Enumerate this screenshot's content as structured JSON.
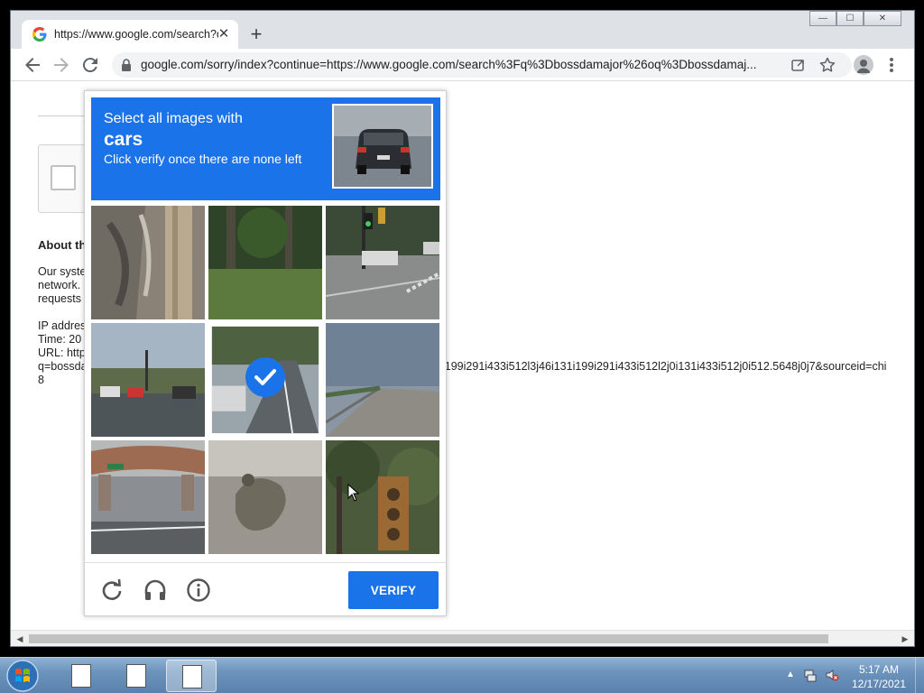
{
  "browser": {
    "tab": {
      "title": "https://www.google.com/search?q",
      "close_glyph": "✕"
    },
    "new_tab_glyph": "+",
    "window_controls": {
      "minimize": "—",
      "maximize": "☐",
      "close": "✕"
    },
    "address_bar": {
      "url": "google.com/sorry/index?continue=https://www.google.com/search%3Fq%3Dbossdamajor%26oq%3Dbossdamaj..."
    }
  },
  "page": {
    "about_heading": "About th",
    "paragraph_lines": [
      "Our syste",
      "network.",
      "requests"
    ],
    "ip_line": "IP addres",
    "time_line": "Time: 20",
    "url_line": "URL: http",
    "q_line": "q=bossda",
    "url_tail": "i199i291i433i512l3j46i131i199i291i433i512l2j0i131i433i512j0i512.5648j0j7&sourceid=chi",
    "eight": "8"
  },
  "captcha": {
    "instruction_line1": "Select all images with",
    "target_word": "cars",
    "instruction_line3": "Click verify once there are none left",
    "verify_label": "VERIFY",
    "tiles_selected": [
      false,
      false,
      false,
      false,
      true,
      false,
      false,
      false,
      false
    ]
  },
  "taskbar": {
    "time": "5:17 AM",
    "date": "12/17/2021"
  },
  "colors": {
    "accent": "#1a73e8"
  }
}
